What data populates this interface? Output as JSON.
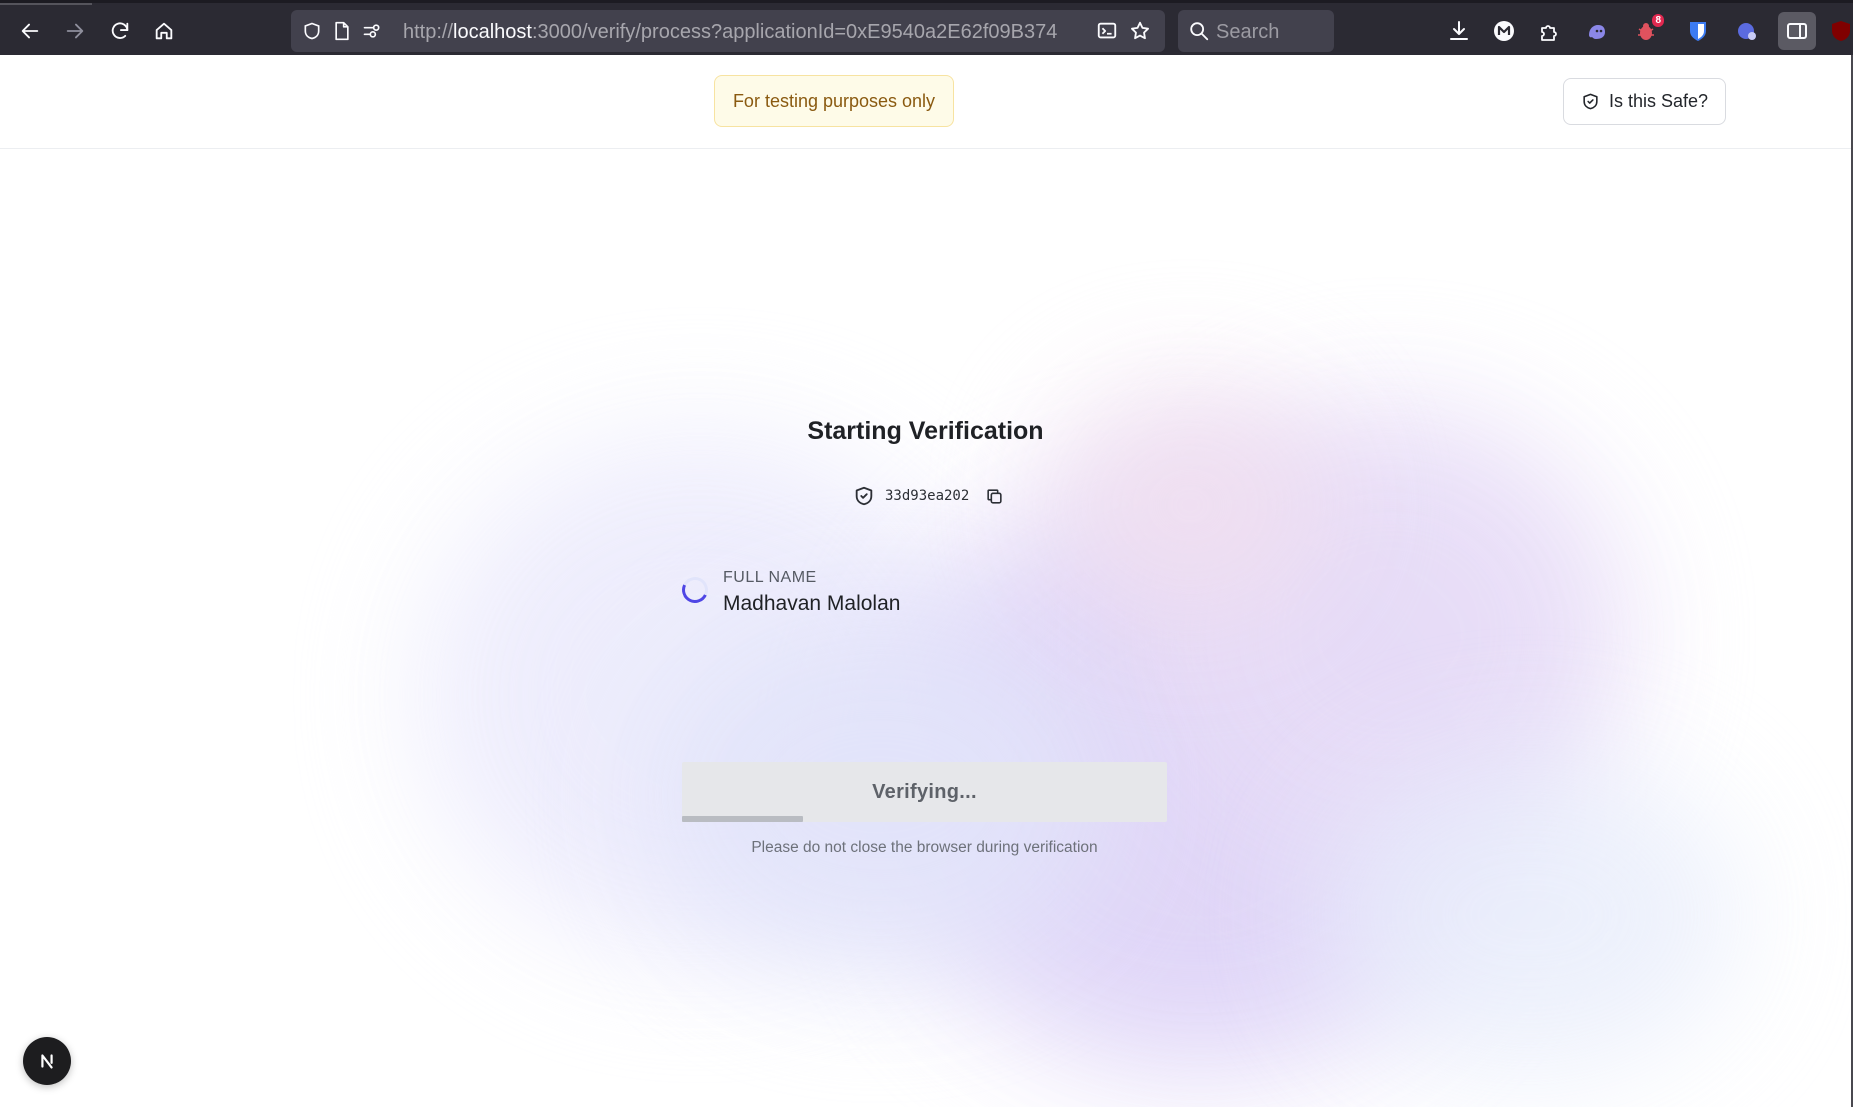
{
  "browser": {
    "url_prefix": "http://",
    "url_host": "localhost",
    "url_rest": ":3000/verify/process?applicationId=0xE9540a2E62f09B374",
    "search_placeholder": "Search",
    "extension_badge_count": "8",
    "icons": [
      "back-icon",
      "forward-icon",
      "reload-icon",
      "home-icon",
      "shield-icon",
      "page-icon",
      "permissions-icon",
      "translate-icon",
      "bookmark-star-icon",
      "search-icon",
      "download-icon",
      "m-extension-icon",
      "extensions-puzzle-icon",
      "ghost-extension-icon",
      "bug-extension-icon",
      "bitwarden-icon",
      "privacy-extension-icon",
      "sidebar-icon",
      "ublock-icon"
    ]
  },
  "header": {
    "testing_notice": "For testing purposes only",
    "safe_button_label": "Is this Safe?"
  },
  "verification": {
    "title": "Starting Verification",
    "proof_hash": "33d93ea202",
    "field_label": "FULL NAME",
    "field_value": "Madhavan Malolan",
    "status_button_label": "Verifying...",
    "progress_percent": 25,
    "note": "Please do not close the browser during verification"
  },
  "colors": {
    "accent": "#4f46e5",
    "notice_bg": "#fefbe8",
    "notice_text": "#8a5a10",
    "chrome_bg": "#2b2a33"
  }
}
